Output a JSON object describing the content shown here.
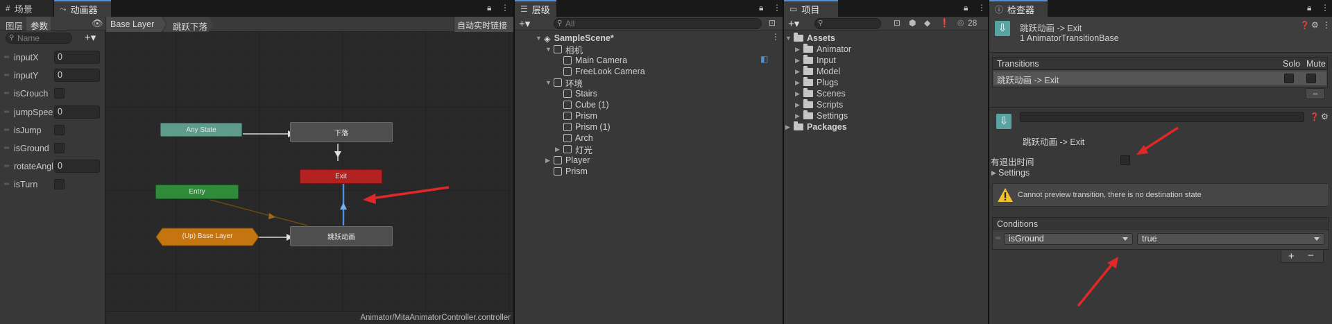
{
  "scene_tab": {
    "label": "场景"
  },
  "animator": {
    "tab_label": "动画器",
    "sub_tabs": [
      "图层",
      "参数"
    ],
    "search_placeholder": "Name",
    "breadcrumb": [
      "Base Layer",
      "跳跃下落"
    ],
    "auto_live_link": "自动实时链接",
    "footer_path": "Animator/MitaAnimatorController.controller",
    "params": [
      {
        "name": "inputX",
        "type": "float",
        "value": "0"
      },
      {
        "name": "inputY",
        "type": "float",
        "value": "0"
      },
      {
        "name": "isCrouch",
        "type": "bool",
        "value": ""
      },
      {
        "name": "jumpSpeed",
        "type": "float",
        "value": "0"
      },
      {
        "name": "isJump",
        "type": "bool",
        "value": ""
      },
      {
        "name": "isGround",
        "type": "bool",
        "value": ""
      },
      {
        "name": "rotateAngle",
        "type": "float",
        "value": "0"
      },
      {
        "name": "isTurn",
        "type": "bool",
        "value": ""
      }
    ],
    "nodes": {
      "any_state": "Any State",
      "fall": "下落",
      "exit": "Exit",
      "entry": "Entry",
      "up_base": "(Up) Base Layer",
      "jump_anim": "跳跃动画"
    }
  },
  "hierarchy": {
    "tab_label": "层级",
    "search_placeholder": "All",
    "items": [
      {
        "label": "SampleScene*",
        "level": 0,
        "fold": "open"
      },
      {
        "label": "相机",
        "level": 1,
        "fold": "open"
      },
      {
        "label": "Main Camera",
        "level": 2,
        "fold": ""
      },
      {
        "label": "FreeLook Camera",
        "level": 2,
        "fold": ""
      },
      {
        "label": "环境",
        "level": 1,
        "fold": "open"
      },
      {
        "label": "Stairs",
        "level": 2,
        "fold": ""
      },
      {
        "label": "Cube (1)",
        "level": 2,
        "fold": ""
      },
      {
        "label": "Prism",
        "level": 2,
        "fold": ""
      },
      {
        "label": "Prism (1)",
        "level": 2,
        "fold": ""
      },
      {
        "label": "Arch",
        "level": 2,
        "fold": ""
      },
      {
        "label": "灯光",
        "level": 2,
        "fold": "closed"
      },
      {
        "label": "Player",
        "level": 1,
        "fold": "closed"
      },
      {
        "label": "Prism",
        "level": 1,
        "fold": ""
      }
    ]
  },
  "project": {
    "tab_label": "项目",
    "hidden_count": "28",
    "items": [
      {
        "label": "Assets",
        "level": 0,
        "fold": "open"
      },
      {
        "label": "Animator",
        "level": 1,
        "fold": "closed"
      },
      {
        "label": "Input",
        "level": 1,
        "fold": "closed"
      },
      {
        "label": "Model",
        "level": 1,
        "fold": "closed"
      },
      {
        "label": "Plugs",
        "level": 1,
        "fold": "closed"
      },
      {
        "label": "Scenes",
        "level": 1,
        "fold": "closed"
      },
      {
        "label": "Scripts",
        "level": 1,
        "fold": "closed"
      },
      {
        "label": "Settings",
        "level": 1,
        "fold": "closed"
      },
      {
        "label": "Packages",
        "level": 0,
        "fold": "closed"
      }
    ]
  },
  "inspector": {
    "tab_label": "检查器",
    "title": "跳跃动画 -> Exit",
    "subtitle": "1 AnimatorTransitionBase",
    "transitions_header": "Transitions",
    "solo_label": "Solo",
    "mute_label": "Mute",
    "transition_item": "跳跃动画 -> Exit",
    "detail_name": "跳跃动画 -> Exit",
    "has_exit_time_label": "有退出时间",
    "settings_label": "Settings",
    "warning": "Cannot preview transition, there is no destination state",
    "conditions_header": "Conditions",
    "condition_param": "isGround",
    "condition_value": "true",
    "minus": "−",
    "plus": "+"
  },
  "colors": {
    "accent_tab": "#4d90d6",
    "any_state": "#5e9b8a",
    "exit_node": "#b32121",
    "entry_node": "#2f8a3a",
    "up_node": "#c5750f",
    "annotation_arrow": "#e02828"
  }
}
